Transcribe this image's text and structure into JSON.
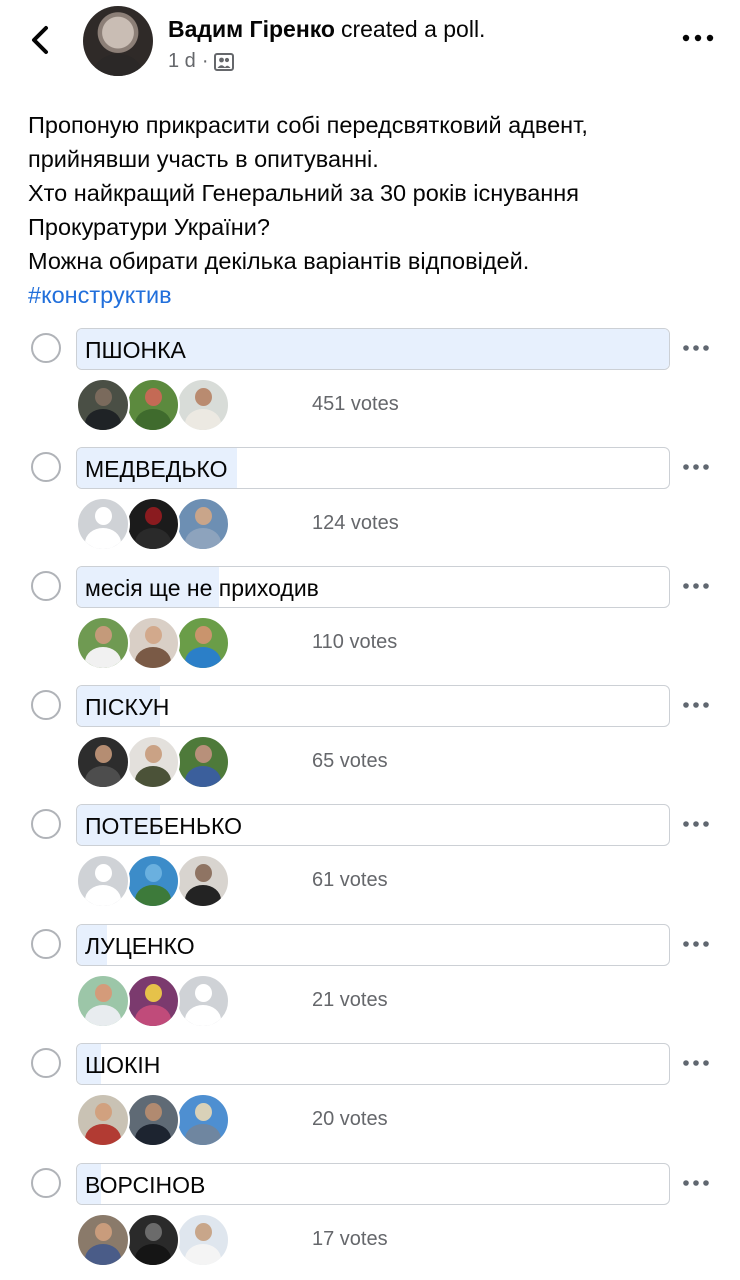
{
  "post": {
    "author": "Вадим Гіренко",
    "action": "created a poll.",
    "time": "1 d",
    "separator": "·",
    "audience_icon": "friends-audience-icon",
    "text_lines": [
      "Пропоную прикрасити собі передсвятковий адвент,",
      "прийнявши участь в опитуванні.",
      "Хто найкращий Генеральний за 30 років існування",
      "Прокуратури України?",
      "Можна обирати декілька варіантів відповідей."
    ],
    "hashtag": "#конструктив"
  },
  "poll": {
    "options": [
      {
        "label": "ПШОНКА",
        "votes": "451 votes",
        "fill_percent": 100,
        "avatars": [
          {
            "bg": "#4a4f45",
            "head": "#7a6a5c",
            "body": "#1f2326"
          },
          {
            "bg": "#5c8a3e",
            "head": "#c46a55",
            "body": "#3f6b2d"
          },
          {
            "bg": "#d8dcd8",
            "head": "#b98b70",
            "body": "#ece9e2"
          }
        ]
      },
      {
        "label": "МЕДВЕДЬКО",
        "votes": "124 votes",
        "fill_percent": 27,
        "avatars": [
          {
            "bg": "#cfd2d6",
            "head": "#ffffff",
            "body": "#ffffff"
          },
          {
            "bg": "#1b1b1b",
            "head": "#8a1b1f",
            "body": "#2a2a2a"
          },
          {
            "bg": "#6d8fb3",
            "head": "#c9a58a",
            "body": "#8da3bd"
          }
        ]
      },
      {
        "label": "месія ще не приходив",
        "votes": "110 votes",
        "fill_percent": 24,
        "avatars": [
          {
            "bg": "#6f9a52",
            "head": "#c49a7a",
            "body": "#f1f1f1"
          },
          {
            "bg": "#d9cfc6",
            "head": "#d2a98c",
            "body": "#7a5a46"
          },
          {
            "bg": "#6a9d48",
            "head": "#c9946d",
            "body": "#2b7fc8"
          }
        ]
      },
      {
        "label": "ПІСКУН",
        "votes": "65 votes",
        "fill_percent": 14,
        "avatars": [
          {
            "bg": "#2d2d2d",
            "head": "#b58d72",
            "body": "#4d4d4d"
          },
          {
            "bg": "#e3e0dc",
            "head": "#caa285",
            "body": "#4b5238"
          },
          {
            "bg": "#4e7a3a",
            "head": "#b8907a",
            "body": "#3b5f9c"
          }
        ]
      },
      {
        "label": "ПОТЕБЕНЬКО",
        "votes": "61 votes",
        "fill_percent": 14,
        "avatars": [
          {
            "bg": "#cfd2d6",
            "head": "#ffffff",
            "body": "#ffffff"
          },
          {
            "bg": "#3c8cc9",
            "head": "#6ab0df",
            "body": "#3d7a3a"
          },
          {
            "bg": "#d8d4cf",
            "head": "#8f7463",
            "body": "#232323"
          }
        ]
      },
      {
        "label": "ЛУЦЕНКО",
        "votes": "21 votes",
        "fill_percent": 5,
        "avatars": [
          {
            "bg": "#9cc6a8",
            "head": "#d49b7a",
            "body": "#e8ecef"
          },
          {
            "bg": "#7b3a6e",
            "head": "#e6c24a",
            "body": "#c04b7a"
          },
          {
            "bg": "#cfd2d6",
            "head": "#ffffff",
            "body": "#ffffff"
          }
        ]
      },
      {
        "label": "ШОКІН",
        "votes": "20 votes",
        "fill_percent": 4,
        "avatars": [
          {
            "bg": "#c9c2b4",
            "head": "#d1a17f",
            "body": "#b23b33"
          },
          {
            "bg": "#5f6a75",
            "head": "#b18a70",
            "body": "#1d2430"
          },
          {
            "bg": "#4e8fd1",
            "head": "#d9d1b8",
            "body": "#6f86a0"
          }
        ]
      },
      {
        "label": "ВОРСІНОВ",
        "votes": "17 votes",
        "fill_percent": 4,
        "avatars": [
          {
            "bg": "#8a7a6a",
            "head": "#c99c7c",
            "body": "#4a5c88"
          },
          {
            "bg": "#2a2a2a",
            "head": "#6b6b6b",
            "body": "#151515"
          },
          {
            "bg": "#dfe6ee",
            "head": "#c8a68a",
            "body": "#f4f4f4"
          }
        ]
      }
    ]
  },
  "colors": {
    "fill": "#e7f0fd",
    "border": "#ccd0d5",
    "secondary_text": "#65676b",
    "hashtag": "#216fdb"
  }
}
